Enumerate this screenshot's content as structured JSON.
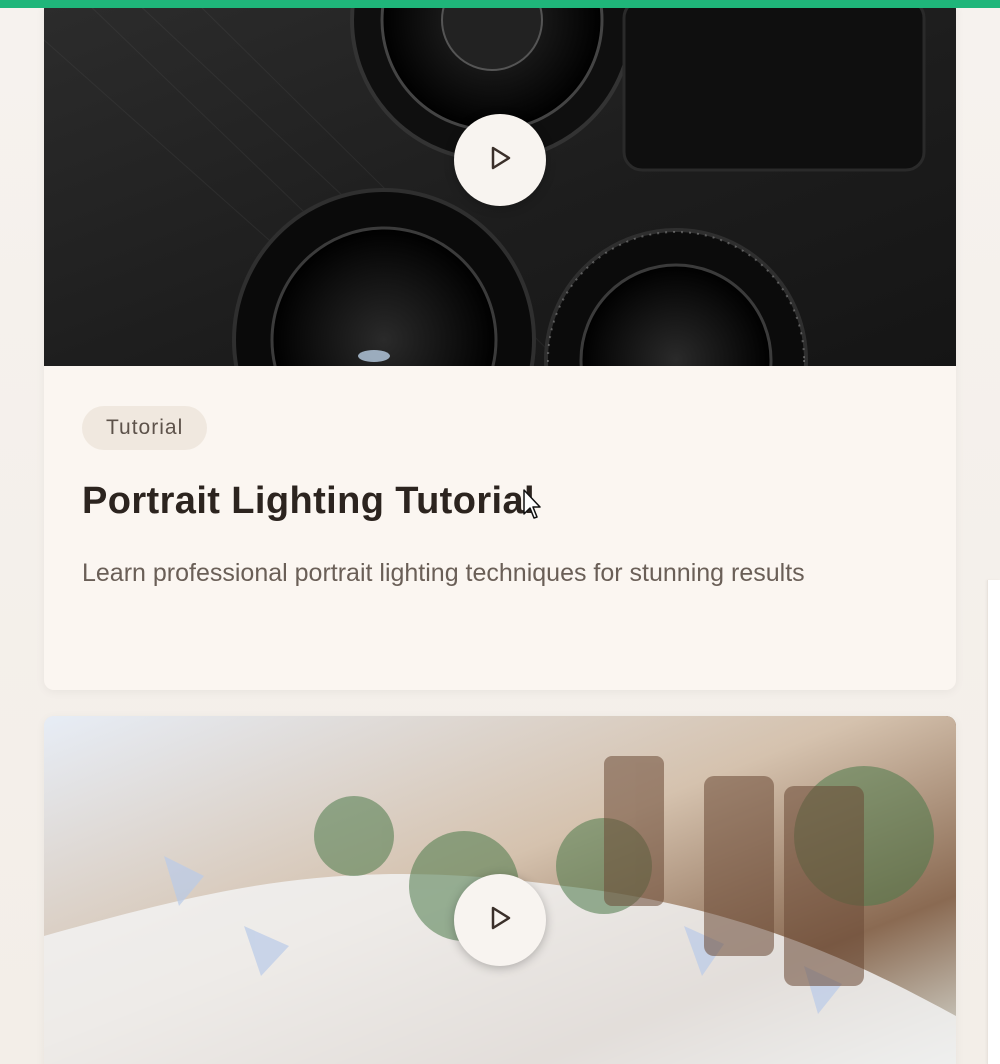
{
  "colors": {
    "accent": "#1fb67a",
    "card_bg": "#fbf6f1",
    "title": "#2c241f",
    "desc": "#6a5f57",
    "chip_bg": "#f0e8df"
  },
  "cards": [
    {
      "category": "Tutorial",
      "title": "Portrait Lighting Tutorial",
      "description": "Learn professional portrait lighting techniques for stunning results",
      "media_icon": "play-icon"
    },
    {
      "media_icon": "play-icon"
    }
  ],
  "icons": {
    "play": "play-icon",
    "cursor": "mouse-pointer-icon"
  }
}
